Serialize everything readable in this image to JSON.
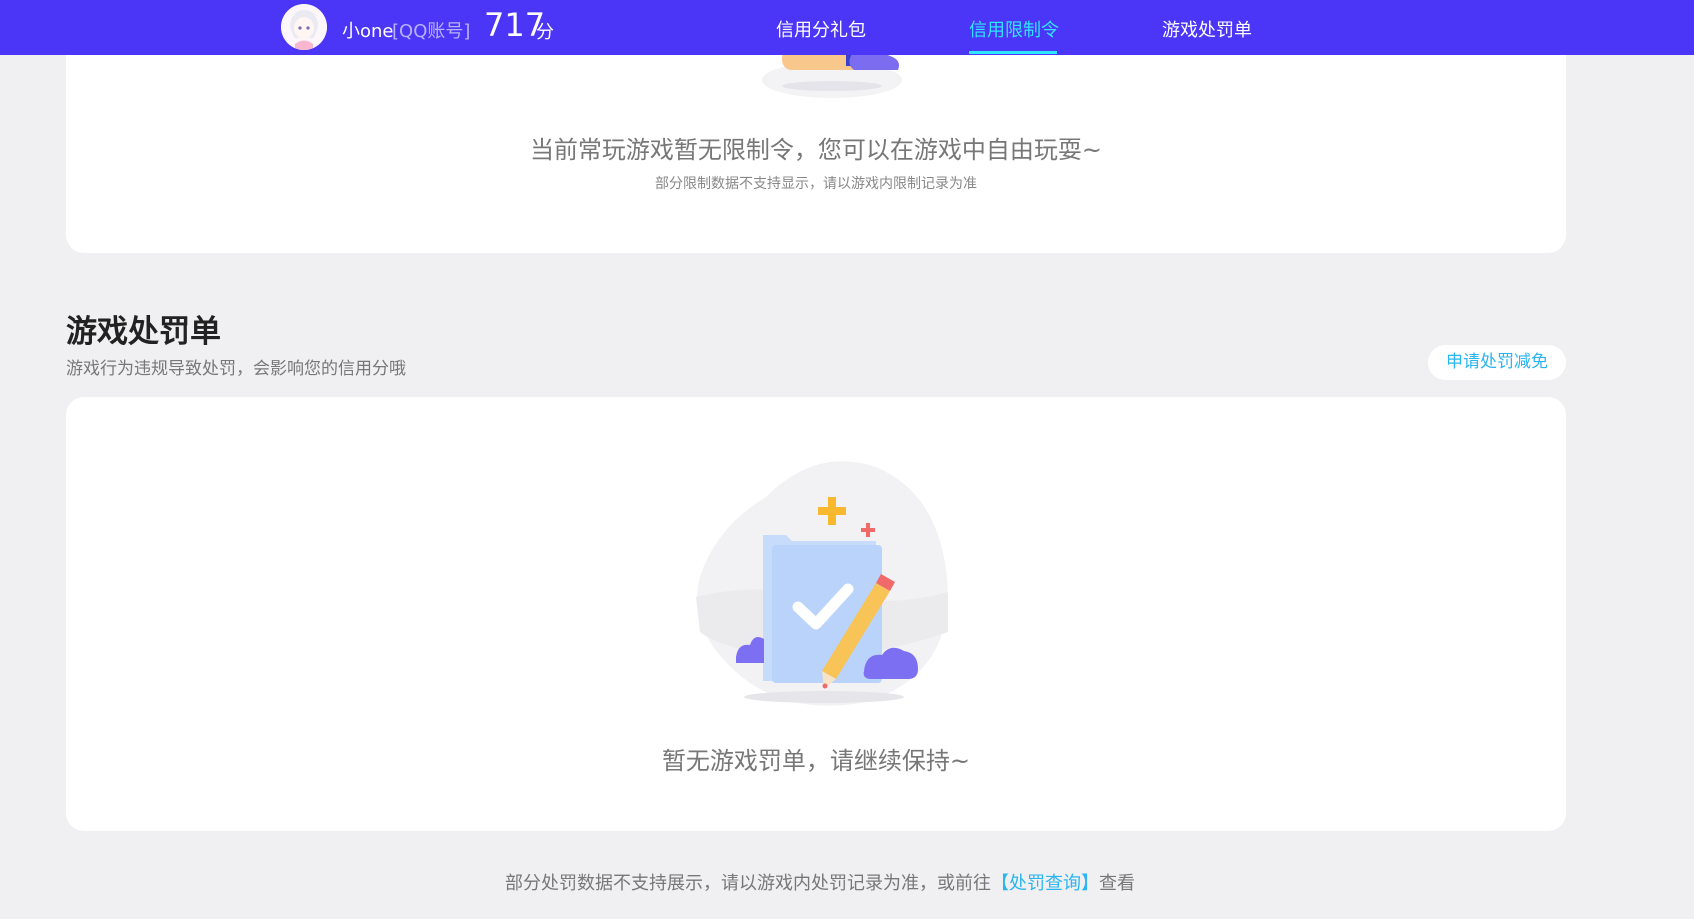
{
  "header": {
    "nickname": "小one",
    "account_type": "[QQ账号]",
    "score": "717",
    "score_unit": "分",
    "nav": [
      {
        "label": "信用分礼包",
        "active": false
      },
      {
        "label": "信用限制令",
        "active": true
      },
      {
        "label": "游戏处罚单",
        "active": false
      }
    ]
  },
  "restriction_card": {
    "message": "当前常玩游戏暂无限制令，您可以在游戏中自由玩耍~",
    "note": "部分限制数据不支持显示，请以游戏内限制记录为准"
  },
  "penalty_section": {
    "title": "游戏处罚单",
    "description": "游戏行为违规导致处罚，会影响您的信用分哦",
    "appeal_button": "申请处罚减免",
    "empty_message": "暂无游戏罚单，请继续保持~"
  },
  "footer": {
    "text_before": "部分处罚数据不支持展示，请以游戏内处罚记录为准，或前往",
    "link": "【处罚查询】",
    "text_after": "查看"
  },
  "colors": {
    "header_bg": "#4b35f7",
    "active_nav": "#2ee6ff",
    "link": "#29b5f0",
    "page_bg": "#f0f0f2"
  }
}
